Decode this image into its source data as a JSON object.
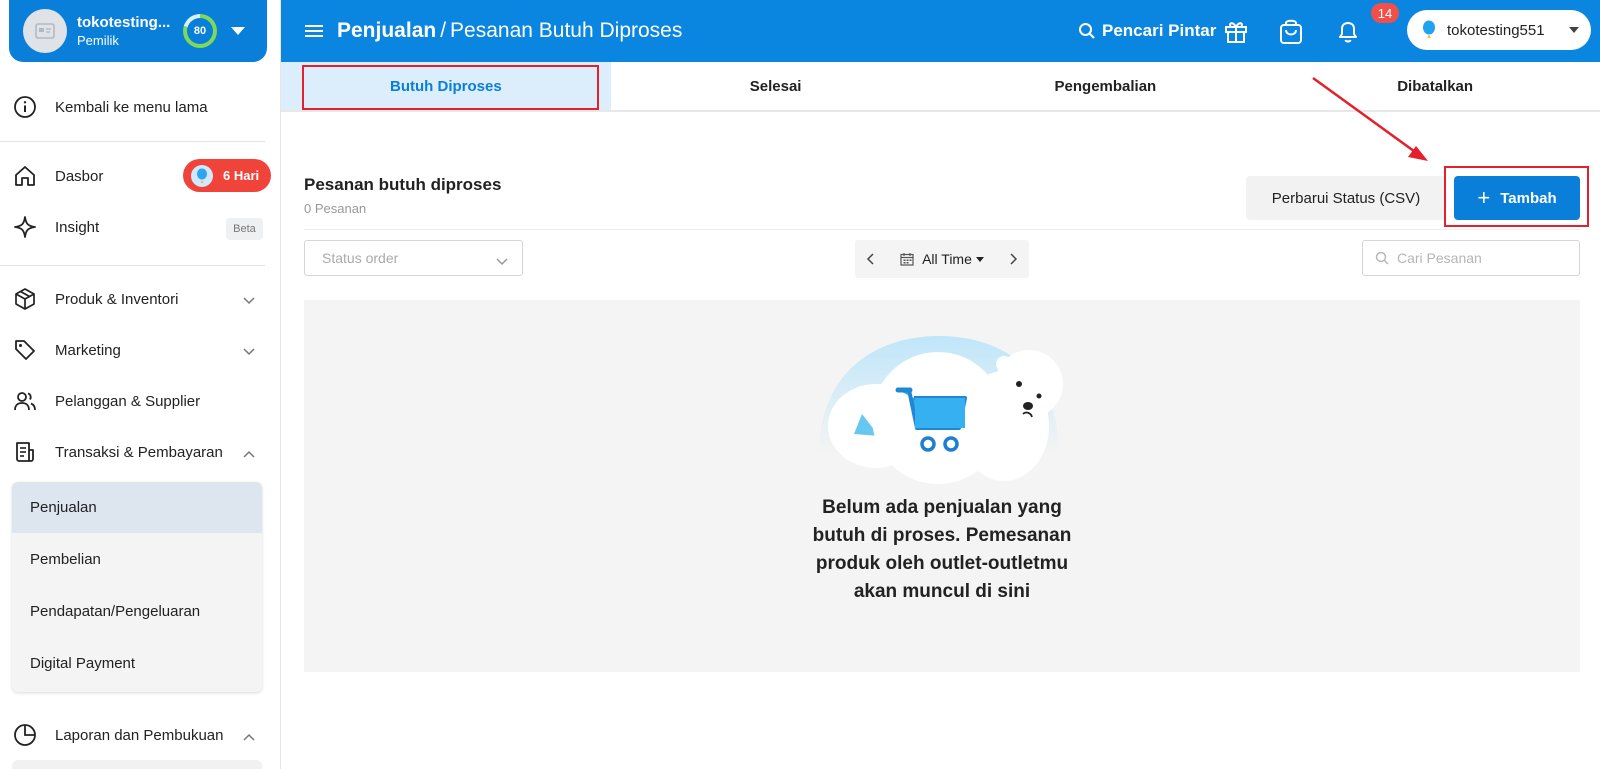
{
  "profile": {
    "name": "tokotesting...",
    "role": "Pemilik",
    "score": "80",
    "avatar_icon": "store-icon"
  },
  "sidebar": {
    "old_menu": "Kembali ke menu lama",
    "items": [
      {
        "label": "Dasbor",
        "icon": "home-icon"
      },
      {
        "label": "Insight",
        "icon": "sparkle-icon"
      },
      {
        "label": "Produk & Inventori",
        "icon": "box-icon"
      },
      {
        "label": "Marketing",
        "icon": "tag-icon"
      },
      {
        "label": "Pelanggan & Supplier",
        "icon": "users-icon"
      },
      {
        "label": "Transaksi & Pembayaran",
        "icon": "receipt-icon"
      },
      {
        "label": "Laporan dan Pembukuan",
        "icon": "pie-chart-icon"
      }
    ],
    "dasbor_badge": "6 Hari",
    "insight_badge": "Beta",
    "submenu": [
      "Penjualan",
      "Pembelian",
      "Pendapatan/Pengeluaran",
      "Digital Payment"
    ]
  },
  "header": {
    "title_main": "Penjualan",
    "title_sep": "/",
    "title_sub": "Pesanan Butuh Diproses",
    "smart_search": "Pencari Pintar",
    "notif_count": "14",
    "outlet": "tokotesting551"
  },
  "tabs": [
    "Butuh Diproses",
    "Selesai",
    "Pengembalian",
    "Dibatalkan"
  ],
  "content": {
    "section_title": "Pesanan butuh diproses",
    "section_count": "0 Pesanan",
    "csv_button": "Perbarui Status (CSV)",
    "add_button": "Tambah",
    "status_placeholder": "Status order",
    "date_range": "All Time",
    "search_placeholder": "Cari Pesanan",
    "empty_message": "Belum ada penjualan yang butuh di proses. Pemesanan produk oleh outlet-outletmu akan muncul di sini"
  },
  "colors": {
    "brand": "#0a85e0",
    "primary_button": "#0a7fd9",
    "badge_red": "#f0443b",
    "annotation_red": "#e3202b"
  }
}
